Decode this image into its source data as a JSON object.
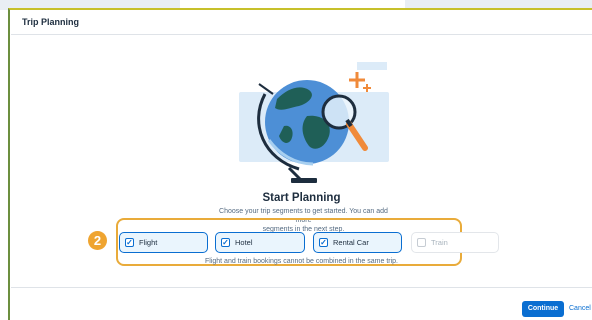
{
  "dialog": {
    "title": "Trip Planning",
    "heading": "Start Planning",
    "subtext_line1": "Choose your trip segments to get started. You can add more",
    "subtext_line2": "segments in the next step.",
    "step_number": "2",
    "segments": [
      {
        "label": "Flight",
        "checked": true,
        "enabled": true
      },
      {
        "label": "Hotel",
        "checked": true,
        "enabled": true
      },
      {
        "label": "Rental Car",
        "checked": true,
        "enabled": true
      },
      {
        "label": "Train",
        "checked": false,
        "enabled": false
      }
    ],
    "note": "Flight and train bookings cannot be combined in the same trip.",
    "continue_label": "Continue",
    "cancel_label": "Cancel"
  },
  "checkmark_glyph": "✓",
  "colors": {
    "accent": "#0a6ed1",
    "highlight": "#e9ab3a",
    "badge": "#efa430",
    "illustration_bg": "#dcebf8",
    "globe": "#4d8fd6",
    "land": "#1f5f57",
    "plus": "#f08a3a"
  },
  "icons": [
    "globe-illustration",
    "magnifier-icon",
    "plus-icon",
    "checkbox-icon"
  ]
}
